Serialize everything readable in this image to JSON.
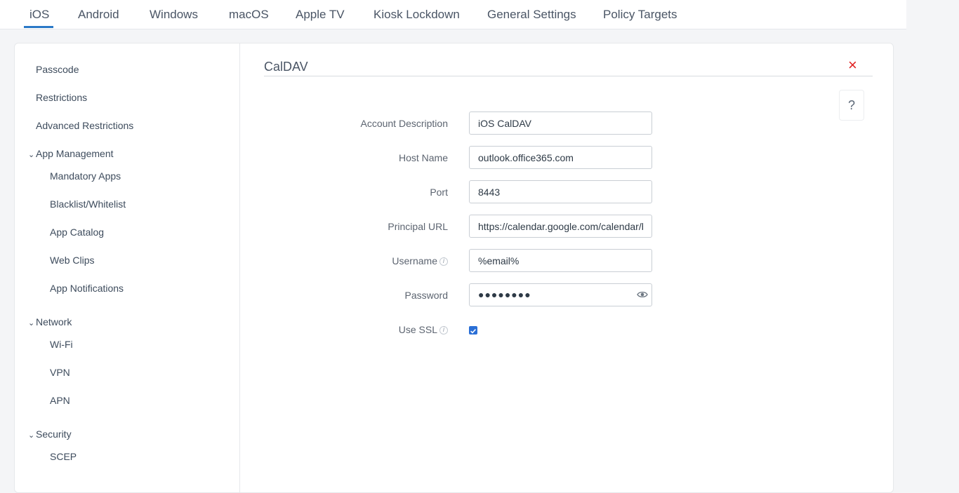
{
  "tabs": [
    {
      "label": "iOS",
      "active": true
    },
    {
      "label": "Android"
    },
    {
      "label": "Windows"
    },
    {
      "label": "macOS"
    },
    {
      "label": "Apple TV"
    },
    {
      "label": "Kiosk Lockdown"
    },
    {
      "label": "General Settings"
    },
    {
      "label": "Policy Targets"
    }
  ],
  "sidebar": {
    "passcode": "Passcode",
    "restrictions": "Restrictions",
    "advanced_restrictions": "Advanced Restrictions",
    "app_management": {
      "label": "App Management",
      "items": [
        "Mandatory Apps",
        "Blacklist/Whitelist",
        "App Catalog",
        "Web Clips",
        "App Notifications"
      ]
    },
    "network": {
      "label": "Network",
      "items": [
        "Wi-Fi",
        "VPN",
        "APN"
      ]
    },
    "security": {
      "label": "Security",
      "items": [
        "SCEP"
      ]
    }
  },
  "panel": {
    "title": "CalDAV",
    "close_icon": "×",
    "help_label": "?",
    "fields": {
      "account_description": {
        "label": "Account Description",
        "value": "iOS CalDAV"
      },
      "host_name": {
        "label": "Host Name",
        "value": "outlook.office365.com"
      },
      "port": {
        "label": "Port",
        "value": "8443"
      },
      "principal_url": {
        "label": "Principal URL",
        "value": "https://calendar.google.com/calendar/b"
      },
      "username": {
        "label": "Username",
        "value": "%email%"
      },
      "password": {
        "label": "Password",
        "masked": "●●●●●●●●"
      },
      "use_ssl": {
        "label": "Use SSL",
        "checked": true
      }
    }
  },
  "colors": {
    "accent": "#2a79c7",
    "close": "#e02020",
    "checkbox": "#2a6fd6"
  }
}
